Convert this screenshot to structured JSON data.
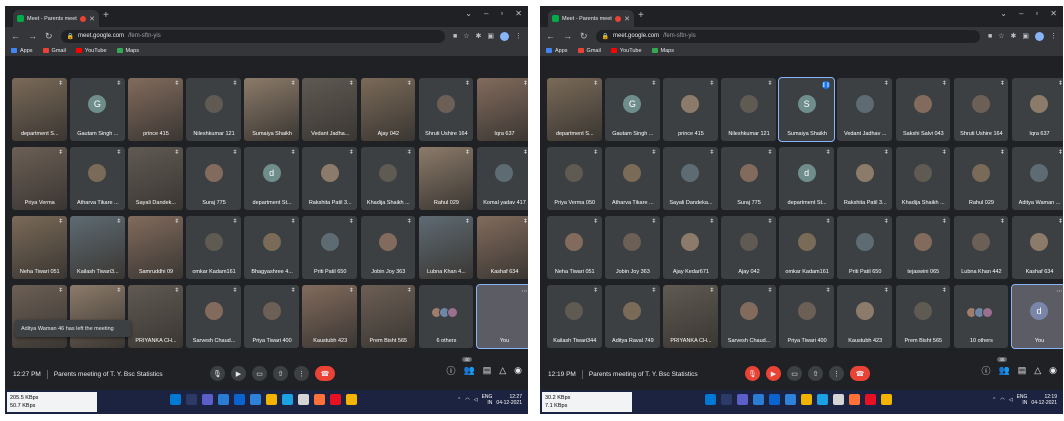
{
  "screenshots": [
    {
      "browser": {
        "tab_title": "Meet - Parents meeting of T.Y.",
        "address_host": "meet.google.com",
        "address_path": "/fem-sftn-yis",
        "bookmarks": [
          {
            "label": "Apps",
            "icon": "apps-icon",
            "color": "#4285f4"
          },
          {
            "label": "Gmail",
            "icon": "gmail-icon",
            "color": "#ea4335"
          },
          {
            "label": "YouTube",
            "icon": "youtube-icon",
            "color": "#ff0000"
          },
          {
            "label": "Maps",
            "icon": "maps-icon",
            "color": "#34a853"
          }
        ]
      },
      "participants": [
        {
          "name": "department S...",
          "kind": "video"
        },
        {
          "name": "Gautam Singh ...",
          "kind": "letter",
          "initial": "G"
        },
        {
          "name": "prince 415",
          "kind": "video"
        },
        {
          "name": "Nileshkumar 121",
          "kind": "photo"
        },
        {
          "name": "Sumaiya Shaikh",
          "kind": "video"
        },
        {
          "name": "Vedant Jadha...",
          "kind": "video"
        },
        {
          "name": "Ajay 042",
          "kind": "video"
        },
        {
          "name": "Shruti Ushire 164",
          "kind": "photo"
        },
        {
          "name": "Iqra 637",
          "kind": "video"
        },
        {
          "name": "Priya Verma",
          "kind": "video"
        },
        {
          "name": "Atharva Tikare ...",
          "kind": "photo"
        },
        {
          "name": "Sayali Dandek...",
          "kind": "video"
        },
        {
          "name": "Suraj 775",
          "kind": "photo"
        },
        {
          "name": "department St...",
          "kind": "letter",
          "initial": "d"
        },
        {
          "name": "Rakshita Patil 3...",
          "kind": "photo"
        },
        {
          "name": "Khadija Shaikh ...",
          "kind": "photo"
        },
        {
          "name": "Rahul 029",
          "kind": "video"
        },
        {
          "name": "Komal yadav 417",
          "kind": "photo"
        },
        {
          "name": "Neha Tiwari 051",
          "kind": "video"
        },
        {
          "name": "Kailash Tiwari3...",
          "kind": "video"
        },
        {
          "name": "Samruddhi 09",
          "kind": "video"
        },
        {
          "name": "omkar Kadam161",
          "kind": "photo"
        },
        {
          "name": "Bhagyashree 4...",
          "kind": "photo"
        },
        {
          "name": "Priti Patil 650",
          "kind": "photo"
        },
        {
          "name": "Jobin Joy 363",
          "kind": "photo"
        },
        {
          "name": "Lubna Khan 4...",
          "kind": "video"
        },
        {
          "name": "Kashaf 634",
          "kind": "video"
        },
        {
          "name": "",
          "kind": "video"
        },
        {
          "name": "",
          "kind": "video"
        },
        {
          "name": "PRIYANKA CH...",
          "kind": "video"
        },
        {
          "name": "Sarvesh Chaud...",
          "kind": "photo"
        },
        {
          "name": "Priya Tiwari 400",
          "kind": "photo"
        },
        {
          "name": "Kaustubh 423",
          "kind": "video"
        },
        {
          "name": "Prem Bisht 565",
          "kind": "video"
        },
        {
          "name": "6 others",
          "kind": "others"
        },
        {
          "name": "You",
          "kind": "self"
        }
      ],
      "toast": "Aditya Waman 46 has left the meeting",
      "meeting": {
        "time": "12:27 PM",
        "title": "Parents meeting of T. Y. Bsc Statistics",
        "participant_count": "40"
      },
      "network": {
        "up": "205.5 KBps",
        "down": "50.7 KBps"
      },
      "tray": {
        "lang": "ENG",
        "region": "IN",
        "time": "12:27",
        "date": "04-12-2021"
      }
    },
    {
      "browser": {
        "tab_title": "Meet - Parents meeting of T.Y.",
        "address_host": "meet.google.com",
        "address_path": "/fem-sftn-yis",
        "bookmarks": [
          {
            "label": "Apps",
            "icon": "apps-icon",
            "color": "#4285f4"
          },
          {
            "label": "Gmail",
            "icon": "gmail-icon",
            "color": "#ea4335"
          },
          {
            "label": "YouTube",
            "icon": "youtube-icon",
            "color": "#ff0000"
          },
          {
            "label": "Maps",
            "icon": "maps-icon",
            "color": "#34a853"
          }
        ]
      },
      "participants": [
        {
          "name": "department S...",
          "kind": "video"
        },
        {
          "name": "Gautam Singh ...",
          "kind": "letter",
          "initial": "G"
        },
        {
          "name": "prince 415",
          "kind": "photo"
        },
        {
          "name": "Nileshkumar 121",
          "kind": "photo"
        },
        {
          "name": "Sumaiya Shaikh",
          "kind": "letter",
          "initial": "S",
          "active": true
        },
        {
          "name": "Vedant Jadhav ...",
          "kind": "photo"
        },
        {
          "name": "Sakshi Salvi 043",
          "kind": "photo"
        },
        {
          "name": "Shruti Ushire 164",
          "kind": "photo"
        },
        {
          "name": "Iqra 637",
          "kind": "photo"
        },
        {
          "name": "Priya Verma 050",
          "kind": "photo"
        },
        {
          "name": "Atharva Tikare ...",
          "kind": "photo"
        },
        {
          "name": "Sayali Dandeka...",
          "kind": "photo"
        },
        {
          "name": "Suraj 775",
          "kind": "photo"
        },
        {
          "name": "department St...",
          "kind": "letter",
          "initial": "d"
        },
        {
          "name": "Rakshita Patil 3...",
          "kind": "photo"
        },
        {
          "name": "Khadija Shaikh ...",
          "kind": "photo"
        },
        {
          "name": "Rahul 029",
          "kind": "photo"
        },
        {
          "name": "Aditya Waman ...",
          "kind": "photo"
        },
        {
          "name": "Neha Tiwari 051",
          "kind": "photo"
        },
        {
          "name": "Jobin Joy 363",
          "kind": "photo"
        },
        {
          "name": "Ajay Kedar671",
          "kind": "photo"
        },
        {
          "name": "Ajay 042",
          "kind": "photo"
        },
        {
          "name": "omkar Kadam161",
          "kind": "photo"
        },
        {
          "name": "Priti Patil 650",
          "kind": "photo"
        },
        {
          "name": "tejaswini 065",
          "kind": "photo"
        },
        {
          "name": "Lubna Khan 442",
          "kind": "photo"
        },
        {
          "name": "Kashaf 634",
          "kind": "photo"
        },
        {
          "name": "Kailash Tiwari344",
          "kind": "photo"
        },
        {
          "name": "Aditya Raval 749",
          "kind": "photo"
        },
        {
          "name": "PRIYANKA CH...",
          "kind": "video"
        },
        {
          "name": "Sarvesh Chaud...",
          "kind": "photo"
        },
        {
          "name": "Priya Tiwari 400",
          "kind": "photo"
        },
        {
          "name": "Kaustubh 423",
          "kind": "photo"
        },
        {
          "name": "Prem Bisht 565",
          "kind": "photo"
        },
        {
          "name": "10 others",
          "kind": "others"
        },
        {
          "name": "You",
          "kind": "self-letter",
          "initial": "d"
        }
      ],
      "toast": "",
      "meeting": {
        "time": "12:19 PM",
        "title": "Parents meeting of T. Y. Bsc Statistics",
        "participant_count": "45"
      },
      "network": {
        "up": "30.2 KBps",
        "down": "7.1 KBps"
      },
      "tray": {
        "lang": "ENG",
        "region": "IN",
        "time": "12:19",
        "date": "04-12-2021"
      }
    }
  ],
  "colors": {
    "meet_bg": "#202124",
    "tile_bg": "#3c4043",
    "end_call": "#ea4335",
    "active_speaker": "#8ab4f8",
    "taskbar": "#1c2340"
  }
}
